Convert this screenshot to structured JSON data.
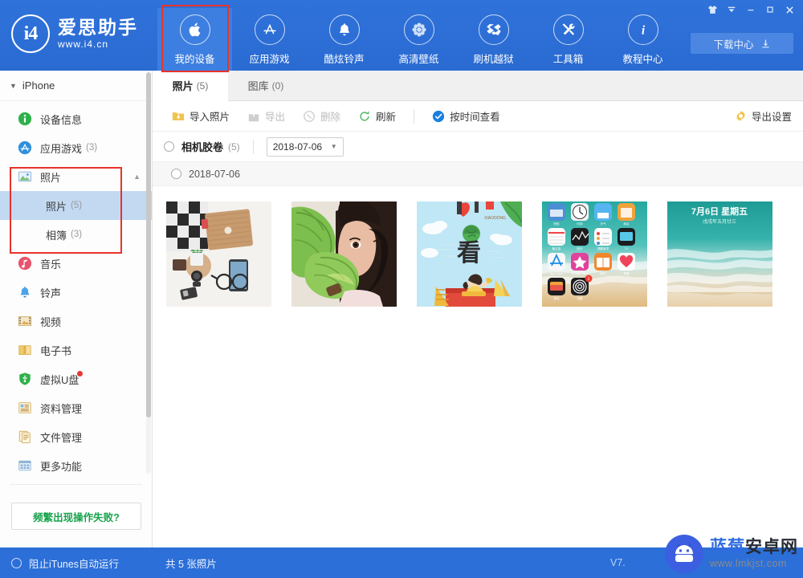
{
  "app": {
    "logo_mark": "i4",
    "title": "爱思助手",
    "subtitle": "www.i4.cn"
  },
  "nav": {
    "items": [
      {
        "label": "我的设备",
        "icon": "apple-icon",
        "active": true
      },
      {
        "label": "应用游戏",
        "icon": "appstore-icon",
        "active": false
      },
      {
        "label": "酷炫铃声",
        "icon": "bell-icon",
        "active": false
      },
      {
        "label": "高清壁纸",
        "icon": "flower-icon",
        "active": false
      },
      {
        "label": "刷机越狱",
        "icon": "box-icon",
        "active": false
      },
      {
        "label": "工具箱",
        "icon": "tools-icon",
        "active": false
      },
      {
        "label": "教程中心",
        "icon": "info-icon",
        "active": false
      }
    ],
    "download_center": "下载中心"
  },
  "window_controls": {
    "skin": "skin-icon",
    "menu": "menu-icon",
    "minimize": "minimize-icon",
    "maximize": "maximize-icon",
    "close": "close-icon"
  },
  "sidebar": {
    "device": "iPhone",
    "items": [
      {
        "label": "设备信息",
        "count": "",
        "icon": "info-circle-icon"
      },
      {
        "label": "应用游戏",
        "count": "(3)",
        "icon": "appstore-circle-icon"
      },
      {
        "label": "照片",
        "count": "",
        "icon": "photo-icon",
        "expanded": true
      },
      {
        "label": "音乐",
        "count": "",
        "icon": "music-icon"
      },
      {
        "label": "铃声",
        "count": "",
        "icon": "ringtone-icon"
      },
      {
        "label": "视频",
        "count": "",
        "icon": "video-icon"
      },
      {
        "label": "电子书",
        "count": "",
        "icon": "book-icon"
      },
      {
        "label": "虚拟U盘",
        "count": "",
        "icon": "usb-icon",
        "badge": true
      },
      {
        "label": "资料管理",
        "count": "",
        "icon": "data-icon"
      },
      {
        "label": "文件管理",
        "count": "",
        "icon": "file-icon"
      },
      {
        "label": "更多功能",
        "count": "",
        "icon": "more-icon"
      }
    ],
    "sub_items": [
      {
        "label": "照片",
        "count": "(5)",
        "selected": true
      },
      {
        "label": "相簿",
        "count": "(3)",
        "selected": false
      }
    ],
    "help_button": "频繁出现操作失败?"
  },
  "main": {
    "tabs": [
      {
        "label": "照片",
        "count": "(5)",
        "active": true
      },
      {
        "label": "图库",
        "count": "(0)",
        "active": false
      }
    ],
    "toolbar": {
      "import": "导入照片",
      "export": "导出",
      "delete": "删除",
      "refresh": "刷新",
      "view_by_time": "按时间查看",
      "export_settings": "导出设置"
    },
    "filter": {
      "album_name": "相机胶卷",
      "album_count": "(5)",
      "date_selected": "2018-07-06"
    },
    "group_row": {
      "date": "2018-07-06"
    },
    "photos": [
      {
        "name": "desk-flatlay-photo",
        "alt": "木质笔记本与桌面摆拍"
      },
      {
        "name": "girl-leaf-portrait-photo",
        "alt": "绿叶遮面人像"
      },
      {
        "name": "spring-illustration-photo",
        "alt": "卡通春日插画"
      },
      {
        "name": "iphone-homescreen-photo",
        "alt": "iPhone主屏截图"
      },
      {
        "name": "iphone-lockscreen-photo",
        "alt": "iPhone锁屏截图 7月6日 星期五"
      }
    ]
  },
  "status": {
    "block_itunes": "阻止iTunes自动运行",
    "total_photos": "共 5 张照片",
    "version": "V7."
  },
  "watermark": {
    "brand_blue": "蓝莓",
    "brand_dark": "安卓网",
    "url": "www.lmkjst.com"
  },
  "colors": {
    "brand_blue": "#2c6fd8",
    "nav_active": "#3d7fe0",
    "selected_row": "#c3d9f2",
    "annotation_red": "#e8332a",
    "help_green": "#16a34a"
  }
}
